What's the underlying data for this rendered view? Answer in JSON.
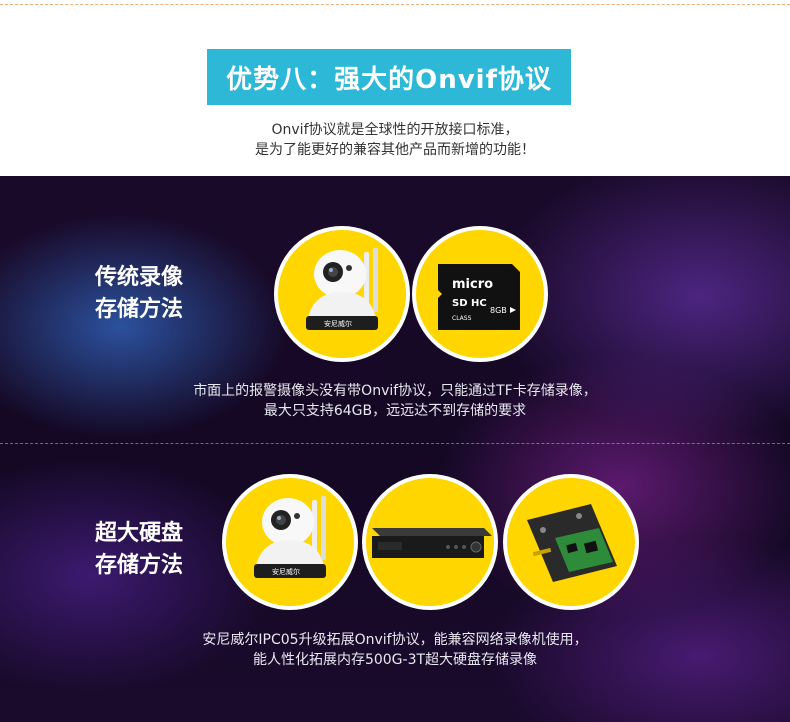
{
  "header": {
    "title": "优势八：强大的Onvif协议",
    "subtitle_line1": "Onvif协议就是全球性的开放接口标准，",
    "subtitle_line2": "是为了能更好的兼容其他产品而新增的功能！"
  },
  "section1": {
    "title_line1": "传统录像",
    "title_line2": "存储方法",
    "desc_line1": "市面上的报警摄像头没有带Onvif协议，只能通过TF卡存储录像，",
    "desc_line2": "最大只支持64GB，远远达不到存储的要求",
    "camera_brand": "安尼威尔",
    "sd_card": {
      "brand": "micro",
      "type": "SD HC",
      "capacity": "8GB",
      "class": "CLASS"
    }
  },
  "section2": {
    "title_line1": "超大硬盘",
    "title_line2": "存储方法",
    "desc_line1": "安尼威尔IPC05升级拓展Onvif协议，能兼容网络录像机使用，",
    "desc_line2": "能人性化拓展内存500G-3T超大硬盘存储录像",
    "camera_brand": "安尼威尔"
  },
  "colors": {
    "banner": "#2db8d8",
    "circle": "#ffd600",
    "panel": "#140824"
  },
  "icons": [
    "ip-camera-icon",
    "micro-sd-card-icon",
    "nvr-recorder-icon",
    "hard-disk-icon"
  ]
}
